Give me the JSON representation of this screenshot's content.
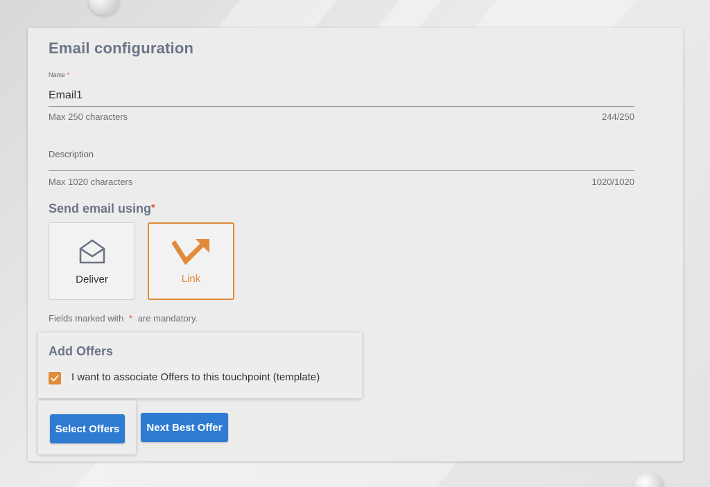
{
  "page": {
    "title": "Email configuration"
  },
  "name_field": {
    "label": "Name",
    "required_mark": "*",
    "value": "Email1",
    "hint": "Max 250 characters",
    "counter": "244/250"
  },
  "description_field": {
    "label": "Description",
    "value": "",
    "hint": "Max 1020 characters",
    "counter": "1020/1020"
  },
  "send_section": {
    "title": "Send email using",
    "required_mark": "*",
    "options": [
      {
        "label": "Deliver",
        "icon": "envelope-open-icon",
        "selected": false
      },
      {
        "label": "Link",
        "icon": "arrow-link-icon",
        "selected": true
      }
    ]
  },
  "mandatory_note": {
    "prefix": "Fields marked with",
    "mark": "*",
    "suffix": "are mandatory."
  },
  "offers": {
    "title": "Add Offers",
    "checkbox_label": "I want to associate Offers to this touchpoint (template)",
    "checked": true
  },
  "buttons": {
    "select_offers": "Select Offers",
    "next_best_offer": "Next Best Offer"
  },
  "colors": {
    "accent": "#e08a3a",
    "primary_button": "#2e7bd3",
    "heading": "#6c7487",
    "required": "#e24b3b"
  }
}
